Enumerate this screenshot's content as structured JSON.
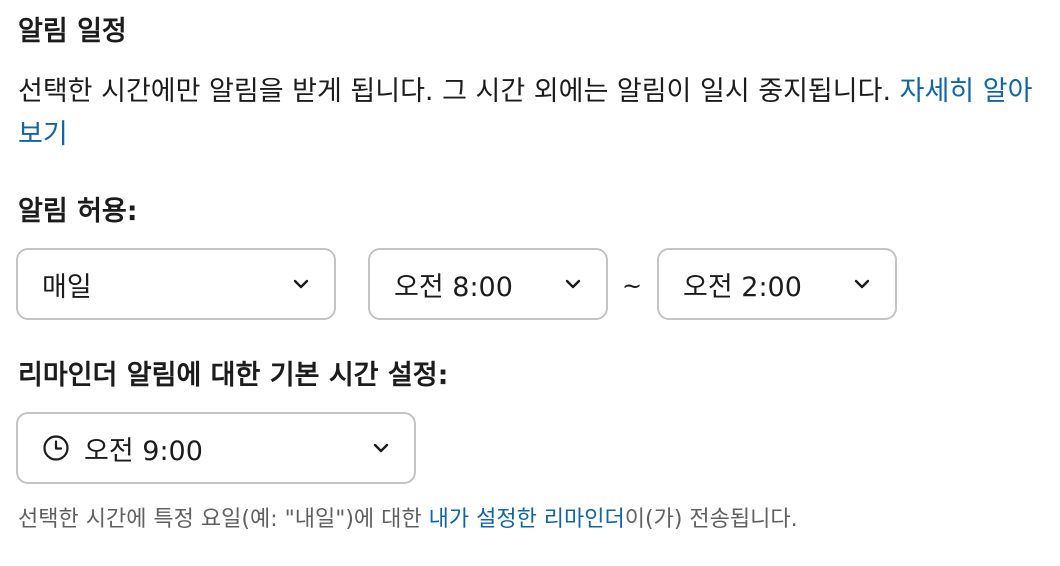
{
  "section": {
    "title": "알림 일정"
  },
  "description": {
    "text": "선택한 시간에만 알림을 받게 됩니다. 그 시간 외에는 알림이 일시 중지됩니다. ",
    "link": "자세히 알아보기"
  },
  "allow": {
    "label": "알림 허용:",
    "days": "매일",
    "start": "오전 8:00",
    "separator": "~",
    "end": "오전 2:00"
  },
  "reminder": {
    "label": "리마인더 알림에 대한 기본 시간 설정:",
    "time": "오전 9:00"
  },
  "footnote": {
    "before": "선택한 시간에 특정 요일(예: \"내일\")에 대한 ",
    "link": "내가 설정한 리마인더",
    "after": "이(가) 전송됩니다."
  },
  "colors": {
    "link": "#1264a3",
    "text": "#1d1c1d",
    "muted": "#616061",
    "border": "#c4c4c5"
  },
  "icons": [
    "chevron-down-icon",
    "clock-icon"
  ]
}
